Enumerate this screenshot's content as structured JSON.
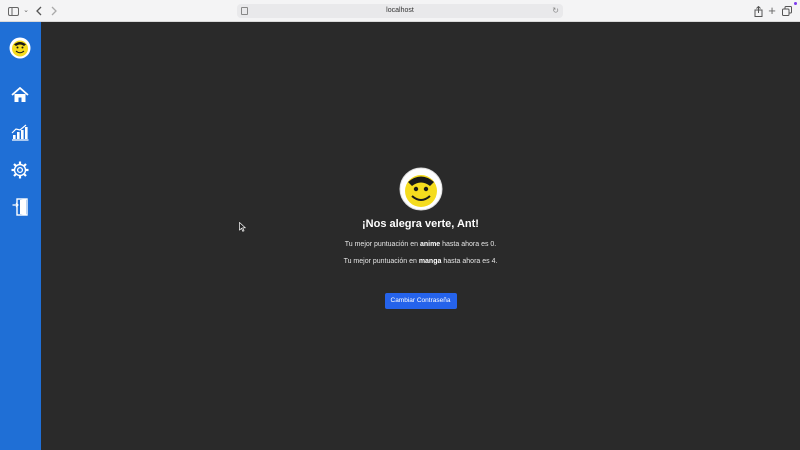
{
  "browser": {
    "url": "localhost"
  },
  "sidebar": {
    "items": [
      {
        "name": "avatar",
        "icon": "koro-sensei-avatar-icon"
      },
      {
        "name": "home",
        "icon": "home-icon"
      },
      {
        "name": "stats",
        "icon": "bar-chart-icon"
      },
      {
        "name": "settings",
        "icon": "gear-icon"
      },
      {
        "name": "logout",
        "icon": "logout-door-icon"
      }
    ],
    "color": "#1f6fd6"
  },
  "main": {
    "greeting": "¡Nos alegra verte, Ant!",
    "score_anime": {
      "prefix": "Tu mejor puntuación en ",
      "category": "anime",
      "suffix": " hasta ahora es 0."
    },
    "score_manga": {
      "prefix": "Tu mejor puntuación en ",
      "category": "manga",
      "suffix": " hasta ahora es 4."
    },
    "change_password_label": "Cambiar Contraseña"
  },
  "colors": {
    "background": "#2a2a2a",
    "accent": "#2563eb"
  }
}
